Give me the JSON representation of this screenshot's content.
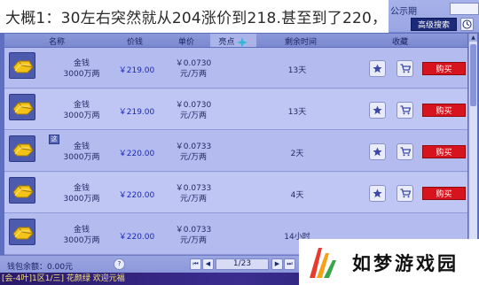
{
  "caption": "大概1：30左右突然就从204涨价到218.甚至到了220，",
  "toolbar": {
    "pub_label": "公示期",
    "adv_search_label": "高级搜索",
    "clock_icon": "clock-icon"
  },
  "header": {
    "name": "名称",
    "price": "价钱",
    "unit_price": "单价",
    "bright": "亮点",
    "remaining": "剩余时间",
    "favorite": "收藏"
  },
  "rows": [
    {
      "name": "金钱",
      "qty": "3000万两",
      "price": "￥219.00",
      "unit": "￥0.0730",
      "unit_sub": "元/万两",
      "remain": "13天",
      "badge": "",
      "buy": "购买"
    },
    {
      "name": "金钱",
      "qty": "3000万两",
      "price": "￥219.00",
      "unit": "￥0.0730",
      "unit_sub": "元/万两",
      "remain": "13天",
      "badge": "",
      "buy": "购买"
    },
    {
      "name": "金钱",
      "qty": "3000万两",
      "price": "￥220.00",
      "unit": "￥0.0733",
      "unit_sub": "元/万两",
      "remain": "2天",
      "badge": "这",
      "buy": "购买"
    },
    {
      "name": "金钱",
      "qty": "3000万两",
      "price": "￥220.00",
      "unit": "￥0.0733",
      "unit_sub": "元/万两",
      "remain": "4天",
      "badge": "",
      "buy": "购买"
    },
    {
      "name": "金钱",
      "qty": "3000万两",
      "price": "￥220.00",
      "unit": "￥0.0733",
      "unit_sub": "元/万两",
      "remain": "14小时",
      "badge": "",
      "buy": "购买"
    }
  ],
  "footer": {
    "wallet": "钱包余额：0.00元",
    "help": "?",
    "page": "1/23"
  },
  "game_strip": "[会-4叶]1区1/三]  花颜绿  欢迎元福",
  "watermark": {
    "text": "如梦游戏园"
  },
  "colors": {
    "buy_button": "#d7141e",
    "adv_search": "#1b2b7a",
    "price_text": "#1c2ab8"
  }
}
